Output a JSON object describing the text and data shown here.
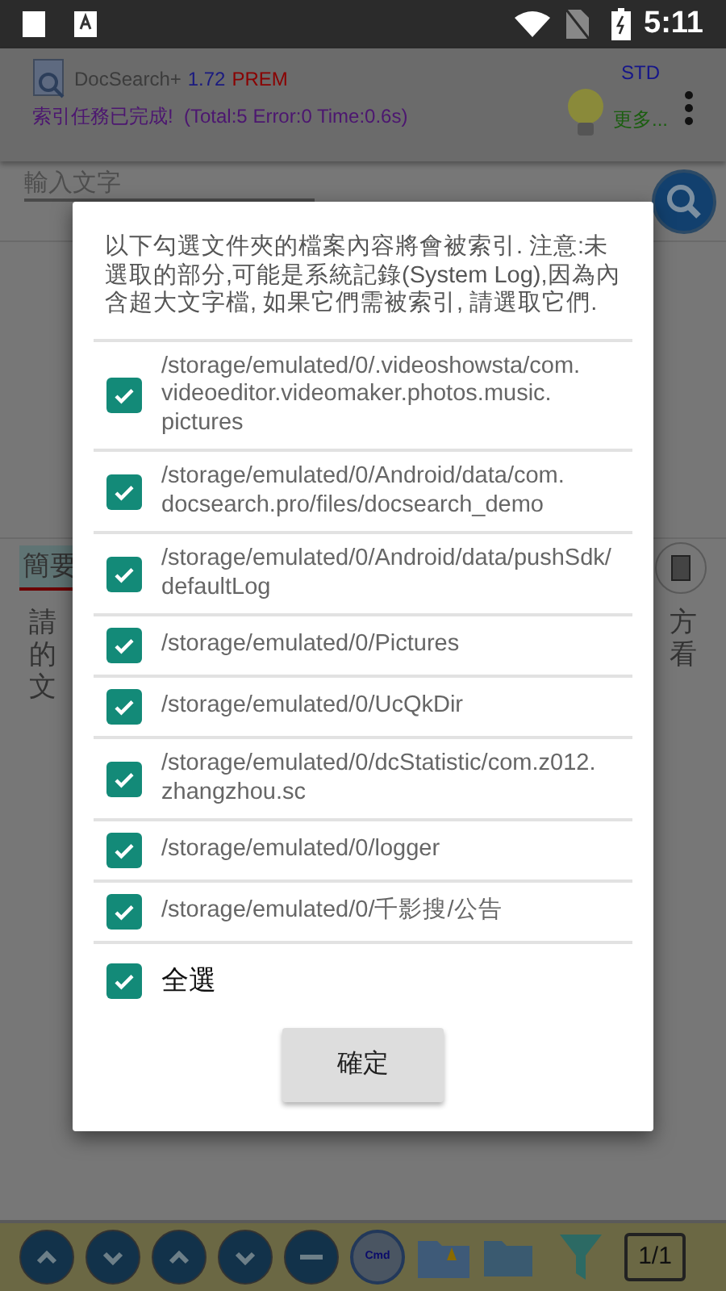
{
  "status_bar": {
    "time": "5:11"
  },
  "header": {
    "app_name": "DocSearch+",
    "version": "1.72",
    "edition": "PREM",
    "mode": "STD",
    "status": "索引任務已完成!  (Total:5 Error:0 Time:0.6s)",
    "more": "更多..."
  },
  "search": {
    "placeholder": "輸入文字"
  },
  "tab": {
    "label": "簡要",
    "selected": true
  },
  "body_left": [
    "請",
    "的",
    "文"
  ],
  "body_right": [
    "方",
    "看"
  ],
  "dialog": {
    "message": "以下勾選文件夾的檔案內容將會被索引. 注意:未選取的部分,可能是系統記錄(System Log),因為內含超大文字檔, 如果它們需被索引, 請選取它們.",
    "folders": [
      {
        "path": "/storage/emulated/0/.videoshowsta/com.videoeditor.videomaker.photos.music.pictures",
        "checked": true
      },
      {
        "path": "/storage/emulated/0/Android/data/com.docsearch.pro/files/docsearch_demo",
        "checked": true
      },
      {
        "path": "/storage/emulated/0/Android/data/pushSdk/defaultLog",
        "checked": true
      },
      {
        "path": "/storage/emulated/0/Pictures",
        "checked": true
      },
      {
        "path": "/storage/emulated/0/UcQkDir",
        "checked": true
      },
      {
        "path": "/storage/emulated/0/dcStatistic/com.z012.zhangzhou.sc",
        "checked": true
      },
      {
        "path": "/storage/emulated/0/logger",
        "checked": true
      },
      {
        "path": "/storage/emulated/0/千影搜/公告",
        "checked": true
      }
    ],
    "select_all": {
      "label": "全選",
      "checked": true
    },
    "ok_button": "確定"
  },
  "toolbar": {
    "cmd_label": "Cmd",
    "page": "1/1"
  }
}
